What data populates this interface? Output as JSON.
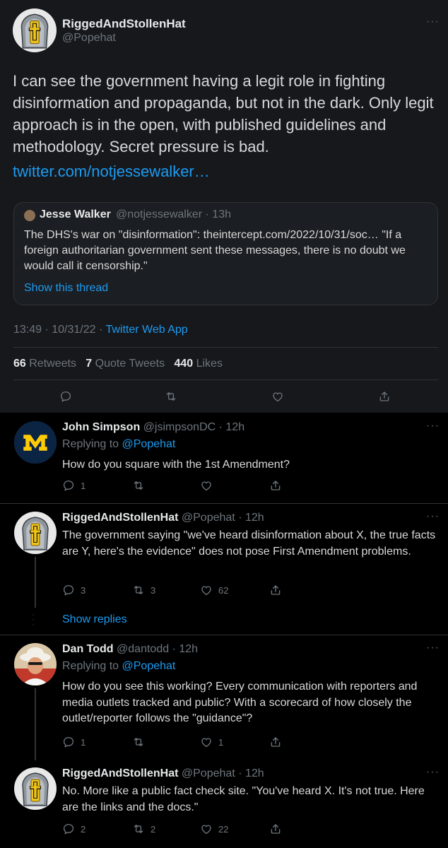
{
  "main_tweet": {
    "name": "RiggedAndStollenHat",
    "handle": "@Popehat",
    "text": "I can see the government having a legit role in fighting disinformation and propaganda, but not in the dark. Only legit approach is in the open, with published guidelines and methodology. Secret pressure is bad.",
    "link": "twitter.com/notjessewalker…",
    "quote": {
      "name": "Jesse Walker",
      "meta": "@notjessewalker · 13h",
      "text": "The DHS's war on \"disinformation\": theintercept.com/2022/10/31/soc… \"If a foreign authoritarian government sent these messages, there is no doubt we would call it censorship.\"",
      "show_thread": "Show this thread"
    },
    "timestamp": "13:49 · 10/31/22 · ",
    "source": "Twitter Web App",
    "stats": {
      "retweets_count": "66",
      "retweets_label": "Retweets",
      "quotes_count": "7",
      "quotes_label": "Quote Tweets",
      "likes_count": "440",
      "likes_label": "Likes"
    }
  },
  "replies": [
    {
      "name": "John Simpson",
      "meta": "@jsimpsonDC · 12h",
      "replying_label": "Replying to ",
      "replying_to": "@Popehat",
      "text": "How do you square with the 1st Amendment?",
      "reply_count": "1",
      "retweet_count": "",
      "like_count": ""
    },
    {
      "name": "RiggedAndStollenHat",
      "meta": "@Popehat · 12h",
      "text": "The government saying \"we've heard disinformation about X, the true facts are Y, here's the evidence\" does not pose First Amendment problems.",
      "reply_count": "3",
      "retweet_count": "3",
      "like_count": "62"
    },
    {
      "name": "Dan Todd",
      "meta": "@dantodd · 12h",
      "replying_label": "Replying to ",
      "replying_to": "@Popehat",
      "text": "How do you see this working? Every communication with reporters and media outlets tracked and public? With a scorecard of how closely the outlet/reporter follows the \"guidance\"?",
      "reply_count": "1",
      "retweet_count": "",
      "like_count": "1"
    },
    {
      "name": "RiggedAndStollenHat",
      "meta": "@Popehat · 12h",
      "text": "No.  More like a public fact check site.  \"You've heard X.  It's not true.  Here are the links and the docs.\"",
      "reply_count": "2",
      "retweet_count": "2",
      "like_count": "22"
    }
  ],
  "show_replies": "Show replies",
  "more_glyph": "···",
  "colors": {
    "background": "#000000",
    "main_tweet_background": "#16181c",
    "link": "#1d9bf0",
    "muted": "#6e767d",
    "divider": "#2f3336"
  },
  "icons": [
    "reply-icon",
    "retweet-icon",
    "like-icon",
    "share-icon",
    "more-icon",
    "block-m-logo",
    "helmet-cross-avatar"
  ]
}
